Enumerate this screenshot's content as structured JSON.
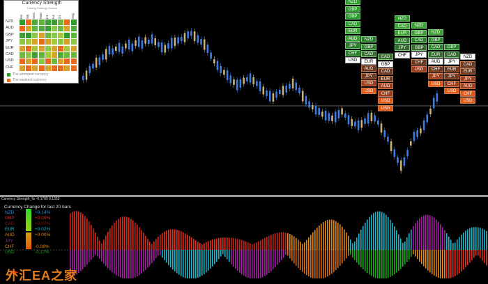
{
  "strength_panel": {
    "title": "Currency Strength",
    "subtitle": "Trading Strategy Guides",
    "timeframes": [
      "M1",
      "M5",
      "M15",
      "M30",
      "H1",
      "H4",
      "D1",
      "",
      "Avg"
    ],
    "currencies": [
      "NZD",
      "AUD",
      "GBP",
      "JPY",
      "EUR",
      "CAD",
      "USD",
      "CHF"
    ],
    "grid": [
      [
        "#2e9b2e",
        "#e86a1a",
        "#4faa3a",
        "#5eb43c",
        "#3f9e35",
        "#3a9a33",
        "#6cb840",
        "#e86a1a",
        "#2e9b2e"
      ],
      [
        "#e86a1a",
        "#d6a22a",
        "#5eb43c",
        "#4faa3a",
        "#3f9e35",
        "#8cc848",
        "#6cb840",
        "#d6a22a",
        "#4faa3a"
      ],
      [
        "#3f9e35",
        "#2e9b2e",
        "#8cc848",
        "#d6a22a",
        "#6cb840",
        "#8cc848",
        "#a5c83c",
        "#2e9b2e",
        "#5eb43c"
      ],
      [
        "#8cc848",
        "#a5c83c",
        "#d6a22a",
        "#e86a1a",
        "#d6a22a",
        "#a5c83c",
        "#8cc848",
        "#d6a22a",
        "#8cc848"
      ],
      [
        "#d6a22a",
        "#e86a1a",
        "#a5c83c",
        "#d6a22a",
        "#8cc848",
        "#d6a22a",
        "#e86a1a",
        "#a5c83c",
        "#d6a22a"
      ],
      [
        "#6cb840",
        "#8cc848",
        "#3f9e35",
        "#5eb43c",
        "#a5c83c",
        "#d6a22a",
        "#4faa3a",
        "#6cb840",
        "#6cb840"
      ],
      [
        "#e86a1a",
        "#d6a22a",
        "#e86a1a",
        "#8cc848",
        "#e86a1a",
        "#6cb840",
        "#d6a22a",
        "#e86a1a",
        "#e86a1a"
      ],
      [
        "#d6a22a",
        "#e86a1a",
        "#d6a22a",
        "#e86a1a",
        "#d6a22a",
        "#e86a1a",
        "#e86a1a",
        "#d6a22a",
        "#e86a1a"
      ]
    ],
    "legend_strong": "The strongest currency",
    "legend_weak": "The weakest currency",
    "color_strong": "#2e9b2e",
    "color_weak": "#e86a1a"
  },
  "rankings": [
    {
      "items": [
        {
          "t": "NZD",
          "c": "g1"
        },
        {
          "t": "GBP",
          "c": "g1"
        },
        {
          "t": "GBP",
          "c": "g1"
        },
        {
          "t": "CAD",
          "c": "g1"
        },
        {
          "t": "EUR",
          "c": "g2"
        },
        {
          "t": "AUD",
          "c": "g2"
        },
        {
          "t": "JPY",
          "c": "g3"
        },
        {
          "t": "CHF",
          "c": "g3"
        },
        {
          "t": "USD",
          "c": "w"
        }
      ]
    },
    {
      "items": [
        {
          "t": "NZD",
          "c": "g3"
        },
        {
          "t": "GBP",
          "c": "g3"
        },
        {
          "t": "CAD",
          "c": "g4"
        },
        {
          "t": "EUR",
          "c": "w"
        },
        {
          "t": "AUD",
          "c": "r1"
        },
        {
          "t": "JPY",
          "c": "r1"
        },
        {
          "t": "USD",
          "c": "r2"
        },
        {
          "t": "USD",
          "c": "r3"
        }
      ]
    },
    {
      "items": [
        {
          "t": "CAD",
          "c": "g4"
        },
        {
          "t": "GBP",
          "c": "w"
        },
        {
          "t": "CAD",
          "c": "r1"
        },
        {
          "t": "EUR",
          "c": "r1"
        },
        {
          "t": "AUD",
          "c": "r2"
        },
        {
          "t": "CHF",
          "c": "r2"
        },
        {
          "t": "USD",
          "c": "r3"
        },
        {
          "t": "USD",
          "c": "r3"
        }
      ]
    },
    {
      "items": [
        {
          "t": "NZD",
          "c": "g1"
        },
        {
          "t": "CAD",
          "c": "g2"
        },
        {
          "t": "EUR",
          "c": "g2"
        },
        {
          "t": "AUD",
          "c": "g3"
        },
        {
          "t": "JPY",
          "c": "g4"
        },
        {
          "t": "CHF",
          "c": "w"
        }
      ]
    },
    {
      "items": [
        {
          "t": "NZD",
          "c": "g2"
        },
        {
          "t": "GBP",
          "c": "g2"
        },
        {
          "t": "CAD",
          "c": "g3"
        },
        {
          "t": "GBP",
          "c": "g4"
        },
        {
          "t": "JPY",
          "c": "w"
        },
        {
          "t": "CHF",
          "c": "r1"
        },
        {
          "t": "USD",
          "c": "r2"
        }
      ]
    },
    {
      "items": [
        {
          "t": "NZD",
          "c": "g2"
        },
        {
          "t": "GBP",
          "c": "g3"
        },
        {
          "t": "CAD",
          "c": "g3"
        },
        {
          "t": "EUR",
          "c": "g4"
        },
        {
          "t": "AUD",
          "c": "w"
        },
        {
          "t": "CHF",
          "c": "r1"
        },
        {
          "t": "JPY",
          "c": "r2"
        },
        {
          "t": "USD",
          "c": "r3"
        }
      ]
    },
    {
      "items": [
        {
          "t": "GBP",
          "c": "g3"
        },
        {
          "t": "CAD",
          "c": "g4"
        },
        {
          "t": "JPY",
          "c": "w"
        },
        {
          "t": "EUR",
          "c": "r1"
        },
        {
          "t": "JPY",
          "c": "r1"
        },
        {
          "t": "CHF",
          "c": "r2"
        },
        {
          "t": "USD",
          "c": "r3"
        }
      ]
    },
    {
      "items": [
        {
          "t": "NZD",
          "c": "w"
        },
        {
          "t": "CAD",
          "c": "r1"
        },
        {
          "t": "EUR",
          "c": "r1"
        },
        {
          "t": "JPY",
          "c": "r2"
        },
        {
          "t": "AUD",
          "c": "r2"
        },
        {
          "t": "CHF",
          "c": "r3"
        },
        {
          "t": "USD",
          "c": "r3"
        }
      ]
    }
  ],
  "rank_colors": {
    "g1": "#2e9b2e",
    "g2": "#3f9e35",
    "g3": "#2f7d2f",
    "g4": "#3a6b32",
    "w": "#ffffff",
    "r1": "#6b3a22",
    "r2": "#9c3f1e",
    "r3": "#e05a18"
  },
  "subwindow": {
    "title": "Currency Strength_fix -0.1709 0.1353",
    "legend_header": "Currency  Change for last 20 bars",
    "rows": [
      {
        "cur": "NZD",
        "val": "+0.14%",
        "color": "#2a8fd8"
      },
      {
        "cur": "GBP",
        "val": "+0.09%",
        "color": "#e0301e"
      },
      {
        "cur": "CAD",
        "val": "+0.07%",
        "color": "#8b1a1a"
      },
      {
        "cur": "EUR",
        "val": "+0.02%",
        "color": "#1fb5c9"
      },
      {
        "cur": "AUD",
        "val": "+0.00%",
        "color": "#e08a1a"
      },
      {
        "cur": "JPY",
        "val": "",
        "color": "#a020a0"
      },
      {
        "cur": "CHF",
        "val": "-0.08%",
        "color": "#d88a1a"
      },
      {
        "cur": "USD",
        "val": "-0.17%",
        "color": "#1aa81a"
      }
    ]
  },
  "watermark": "外汇EA之家"
}
